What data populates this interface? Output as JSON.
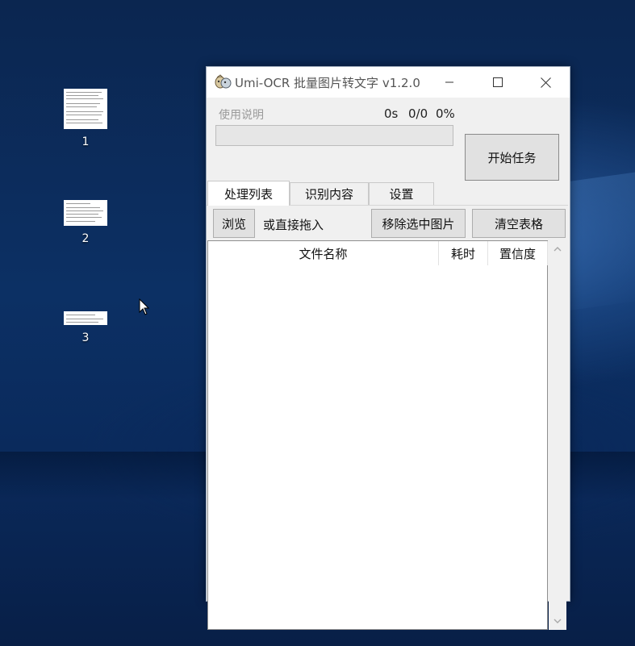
{
  "desktop": {
    "icons": [
      {
        "label": "1"
      },
      {
        "label": "2"
      },
      {
        "label": "3"
      }
    ]
  },
  "window": {
    "title": "Umi-OCR 批量图片转文字 v1.2.0",
    "controls": {
      "minimize": "minimize-icon",
      "maximize": "maximize-icon",
      "close": "close-icon"
    },
    "header": {
      "help_link": "使用说明",
      "elapsed": "0s",
      "count": "0/0",
      "percent": "0%",
      "progress": 0,
      "start_button": "开始任务"
    },
    "tabs": [
      {
        "label": "处理列表",
        "active": true
      },
      {
        "label": "识别内容",
        "active": false
      },
      {
        "label": "设置",
        "active": false
      }
    ],
    "toolbar": {
      "browse": "浏览",
      "drop_hint": "或直接拖入",
      "remove_selected": "移除选中图片",
      "clear_table": "清空表格"
    },
    "table": {
      "columns": [
        "文件名称",
        "耗时",
        "置信度"
      ],
      "rows": []
    }
  },
  "colors": {
    "window_bg": "#f0f0f0",
    "button_bg": "#e1e1e1",
    "desktop_blue": "#0c3064",
    "muted_text": "#9a9a9a"
  }
}
